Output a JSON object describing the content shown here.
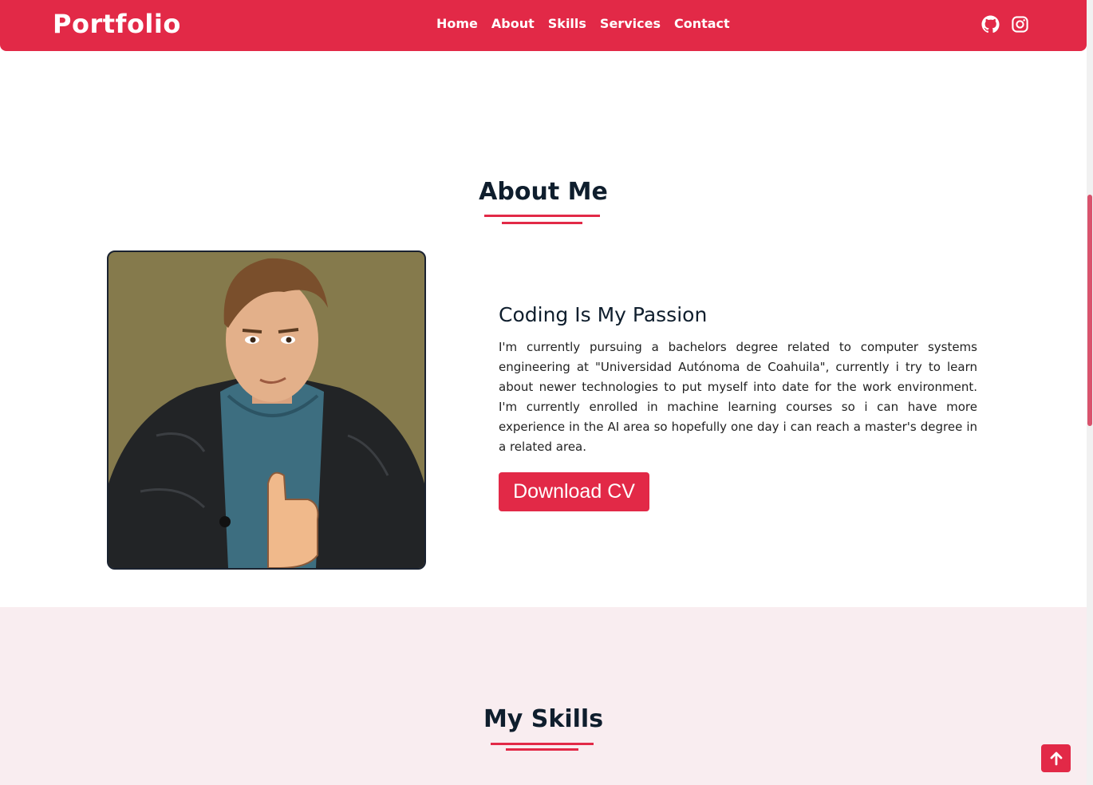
{
  "nav": {
    "brand": "Portfolio",
    "links": [
      "Home",
      "About",
      "Skills",
      "Services",
      "Contact"
    ],
    "socials": [
      "github-icon",
      "instagram-icon"
    ]
  },
  "about": {
    "title": "About Me",
    "subheading": "Coding Is My Passion",
    "paragraph": "I'm currently pursuing a bachelors degree related to computer systems engineering at \"Universidad Autónoma de Coahuila\", currently i try to learn about newer technologies to put myself into date for the work environment. I'm currently enrolled in machine learning courses so i can have more experience in the AI area so hopefully one day i can reach a master's degree in a related area.",
    "button": "Download CV"
  },
  "skills": {
    "title": "My Skills"
  },
  "colors": {
    "accent": "#e22947",
    "text": "#0f1e2d",
    "skills_bg": "#f9edf0",
    "portrait_bg": "#857a4c"
  },
  "scroll_top_icon": "arrow-up-icon"
}
